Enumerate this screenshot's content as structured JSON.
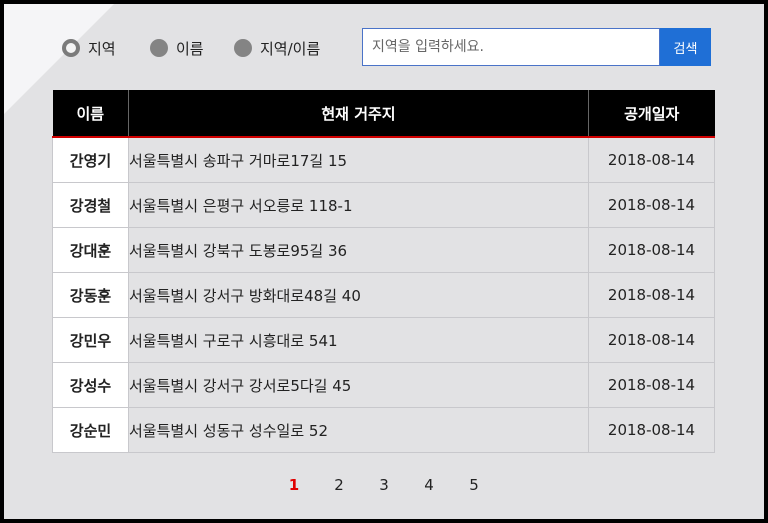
{
  "search": {
    "options": [
      {
        "label": "지역",
        "selected": true
      },
      {
        "label": "이름",
        "selected": false
      },
      {
        "label": "지역/이름",
        "selected": false
      }
    ],
    "placeholder": "지역을 입력하세요.",
    "value": "",
    "button_label": "검색"
  },
  "table": {
    "headers": [
      "이름",
      "현재 거주지",
      "공개일자"
    ],
    "rows": [
      {
        "name": "간영기",
        "address": "서울특별시 송파구 거마로17길 15",
        "date": "2018-08-14"
      },
      {
        "name": "강경철",
        "address": "서울특별시 은평구 서오릉로 118-1",
        "date": "2018-08-14"
      },
      {
        "name": "강대훈",
        "address": "서울특별시 강북구 도봉로95길 36",
        "date": "2018-08-14"
      },
      {
        "name": "강동훈",
        "address": "서울특별시 강서구 방화대로48길 40",
        "date": "2018-08-14"
      },
      {
        "name": "강민우",
        "address": "서울특별시 구로구 시흥대로 541",
        "date": "2018-08-14"
      },
      {
        "name": "강성수",
        "address": "서울특별시 강서구 강서로5다길 45",
        "date": "2018-08-14"
      },
      {
        "name": "강순민",
        "address": "서울특별시 성동구 성수일로 52",
        "date": "2018-08-14"
      }
    ]
  },
  "pagination": {
    "pages": [
      "1",
      "2",
      "3",
      "4",
      "5"
    ],
    "current": "1"
  },
  "colors": {
    "accent": "#1f6fd6",
    "header_bg": "#000000",
    "header_rule": "#d10000",
    "current_page": "#e00000",
    "panel_bg": "#e2e2e4"
  }
}
